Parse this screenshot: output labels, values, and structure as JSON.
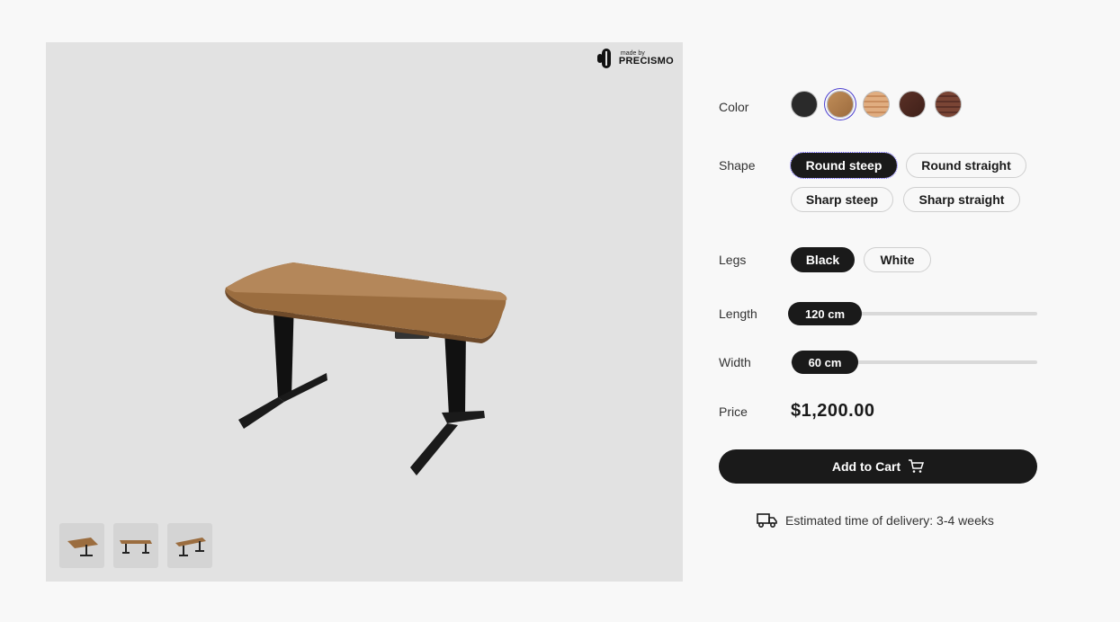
{
  "brand": {
    "small": "made by",
    "name": "PRECISMO"
  },
  "viewer": {
    "thumbnails": [
      "desk-view-1",
      "desk-view-2",
      "desk-view-3"
    ]
  },
  "config": {
    "color": {
      "label": "Color",
      "options": [
        {
          "name": "Black",
          "hex": "#2a2a2a"
        },
        {
          "name": "Oak",
          "hex": "#b07d4a"
        },
        {
          "name": "Light wood",
          "hex": "#d9a47a"
        },
        {
          "name": "Dark walnut",
          "hex": "#4e2a22"
        },
        {
          "name": "Walnut",
          "hex": "#6e3f31"
        }
      ],
      "selected_index": 1
    },
    "shape": {
      "label": "Shape",
      "options": [
        "Round steep",
        "Round straight",
        "Sharp steep",
        "Sharp straight"
      ],
      "selected": "Round steep"
    },
    "legs": {
      "label": "Legs",
      "options": [
        "Black",
        "White"
      ],
      "selected": "Black"
    },
    "length": {
      "label": "Length",
      "value": "120 cm"
    },
    "width": {
      "label": "Width",
      "value": "60 cm"
    },
    "price": {
      "label": "Price",
      "value": "$1,200.00"
    },
    "cart_button": "Add to Cart",
    "delivery": "Estimated time of delivery: 3-4 weeks"
  },
  "colors": {
    "accent": "#1a1a1a",
    "focus": "#4b3fd0",
    "panel_bg": "#e2e2e2",
    "page_bg": "#f8f8f8"
  }
}
